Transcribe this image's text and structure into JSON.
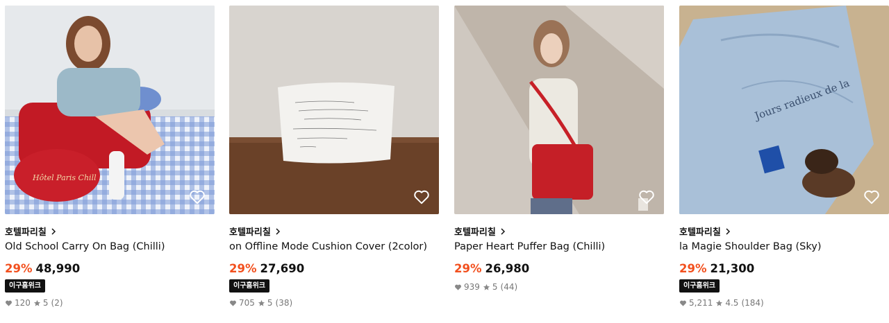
{
  "products": [
    {
      "brand": "호텔파리칠",
      "name": "Old School Carry On Bag (Chilli)",
      "discount": "29%",
      "price": "48,990",
      "badge": "이구홈위크",
      "likes": "120",
      "rating": "5",
      "reviews": "(2)"
    },
    {
      "brand": "호텔파리칠",
      "name": "on Offline Mode Cushion Cover (2color)",
      "discount": "29%",
      "price": "27,690",
      "badge": "이구홈위크",
      "likes": "705",
      "rating": "5",
      "reviews": "(38)"
    },
    {
      "brand": "호텔파리칠",
      "name": "Paper Heart Puffer Bag (Chilli)",
      "discount": "29%",
      "price": "26,980",
      "likes": "939",
      "rating": "5",
      "reviews": "(44)"
    },
    {
      "brand": "호텔파리칠",
      "name": "la Magie Shoulder Bag (Sky)",
      "discount": "29%",
      "price": "21,300",
      "badge": "이구홈위크",
      "likes": "5,211",
      "rating": "4.5",
      "reviews": "(184)"
    }
  ],
  "colors": {
    "discount": "#f2501e",
    "badge_bg": "#111111",
    "meta": "#777777"
  },
  "icons": {
    "wishlist": "heart-outline-icon",
    "brand_link": "chevron-right-icon",
    "likes": "heart-filled-icon",
    "rating": "star-icon"
  }
}
